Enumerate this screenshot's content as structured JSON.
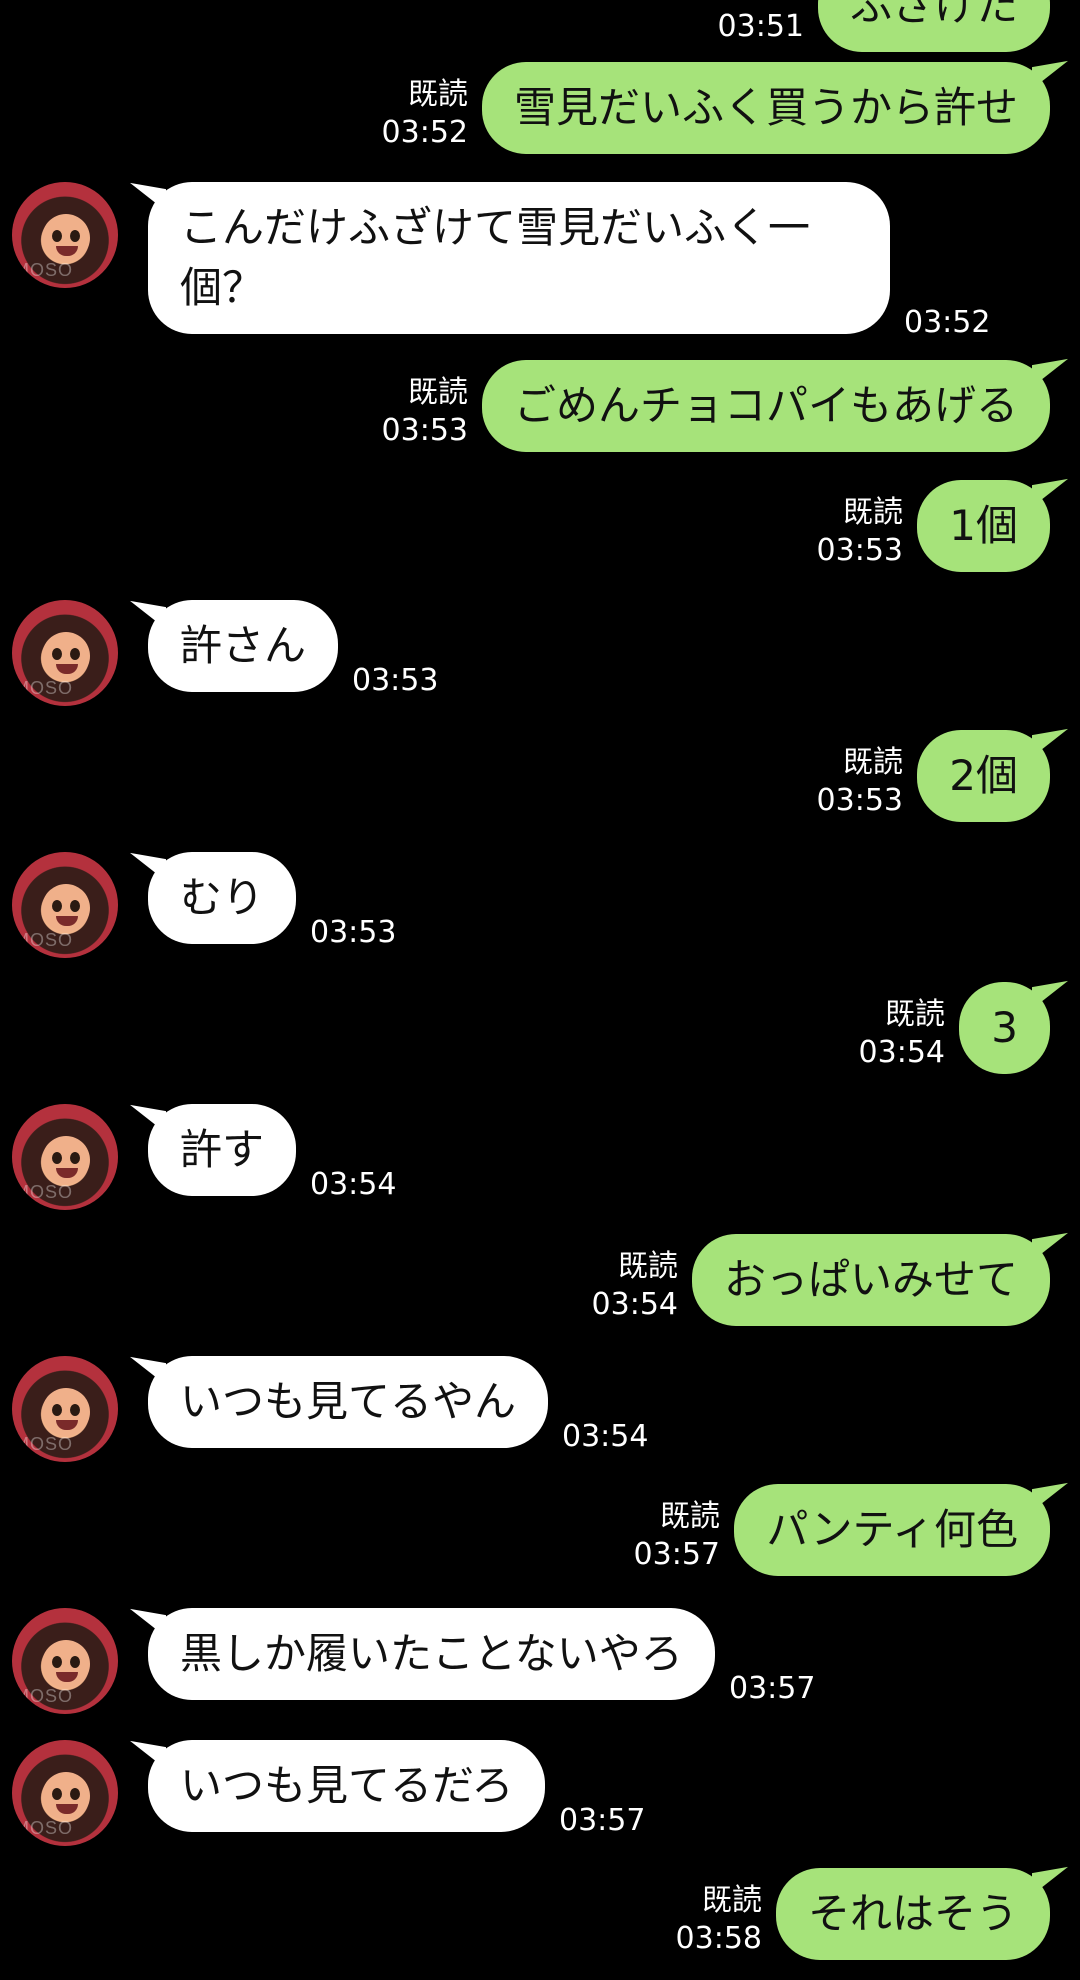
{
  "read_label": "既読",
  "avatar_watermark": "MOSO",
  "messages": [
    {
      "dir": "sent",
      "text": "ふざけた",
      "time": "03:51"
    },
    {
      "dir": "sent",
      "text": "雪見だいふく買うから許せ",
      "time": "03:52",
      "read": true
    },
    {
      "dir": "recv",
      "text": "こんだけふざけて雪見だいふく一\n個？",
      "time": "03:52"
    },
    {
      "dir": "sent",
      "text": "ごめんチョコパイもあげる",
      "time": "03:53",
      "read": true
    },
    {
      "dir": "sent",
      "text": "1個",
      "time": "03:53",
      "read": true
    },
    {
      "dir": "recv",
      "text": "許さん",
      "time": "03:53"
    },
    {
      "dir": "sent",
      "text": "2個",
      "time": "03:53",
      "read": true
    },
    {
      "dir": "recv",
      "text": "むり",
      "time": "03:53"
    },
    {
      "dir": "sent",
      "text": "3",
      "time": "03:54",
      "read": true
    },
    {
      "dir": "recv",
      "text": "許す",
      "time": "03:54"
    },
    {
      "dir": "sent",
      "text": "おっぱいみせて",
      "time": "03:54",
      "read": true
    },
    {
      "dir": "recv",
      "text": "いつも見てるやん",
      "time": "03:54"
    },
    {
      "dir": "sent",
      "text": "パンティ何色",
      "time": "03:57",
      "read": true
    },
    {
      "dir": "recv",
      "text": "黒しか履いたことないやろ",
      "time": "03:57"
    },
    {
      "dir": "recv",
      "text": "いつも見てるだろ",
      "time": "03:57"
    },
    {
      "dir": "sent",
      "text": "それはそう",
      "time": "03:58",
      "read": true
    }
  ]
}
